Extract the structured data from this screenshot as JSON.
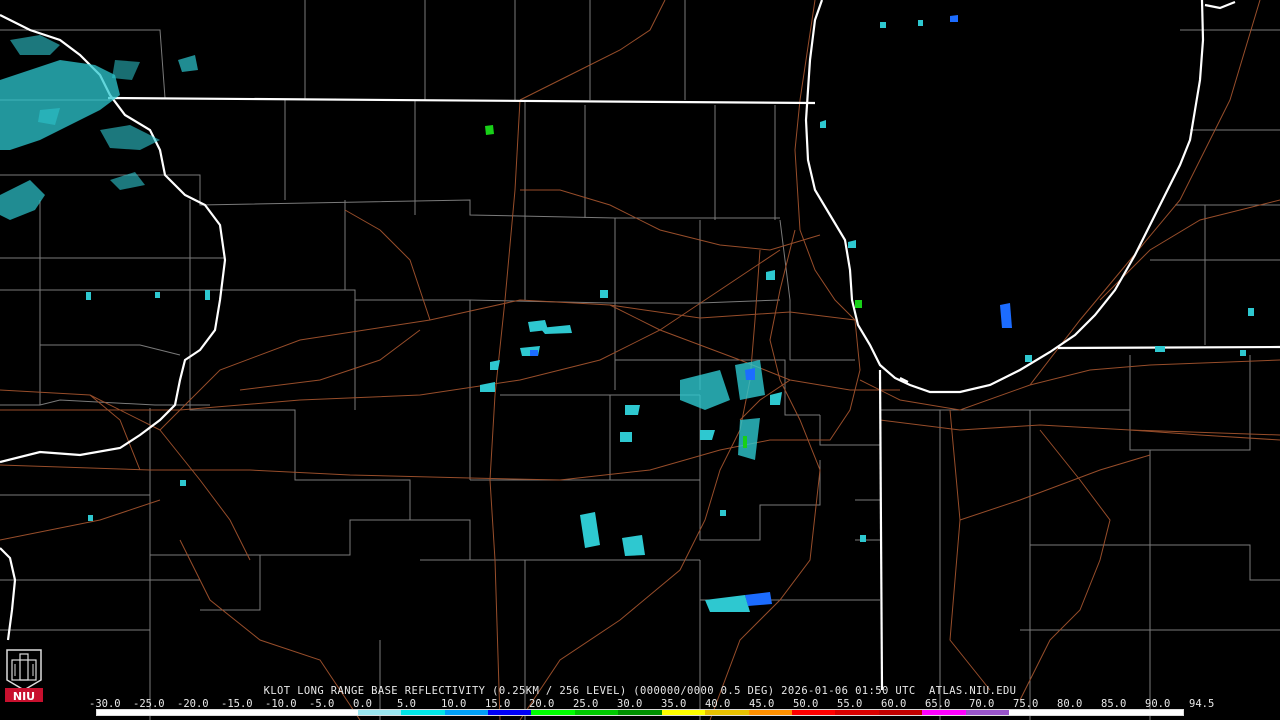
{
  "caption": "KLOT LONG RANGE BASE REFLECTIVITY (0.25KM / 256 LEVEL) (000000/0000 0.5 DEG) 2026-01-06 01:50 UTC  ATLAS.NIU.EDU",
  "scale": {
    "labels": [
      "-30.0",
      "-25.0",
      "-20.0",
      "-15.0",
      "-10.0",
      "-5.0",
      "0.0",
      "5.0",
      "10.0",
      "15.0",
      "20.0",
      "25.0",
      "30.0",
      "35.0",
      "40.0",
      "45.0",
      "50.0",
      "55.0",
      "60.0",
      "65.0",
      "70.0",
      "75.0",
      "80.0",
      "85.0",
      "90.0",
      "94.5"
    ],
    "colors": [
      "#ffffff",
      "#ffffff",
      "#ffffff",
      "#ffffff",
      "#ffffff",
      "#ffffff",
      "#9be7f0",
      "#00e5e5",
      "#01a0f6",
      "#0000f6",
      "#00ff00",
      "#00c800",
      "#009000",
      "#ffff00",
      "#e7c000",
      "#ff9000",
      "#ff0000",
      "#d60000",
      "#c00000",
      "#ff00ff",
      "#9955c9",
      "#ffffff",
      "#ffffff",
      "#ffffff",
      "#ffffff"
    ]
  },
  "logo": {
    "text": "NIU",
    "name": "niu-logo"
  },
  "colors": {
    "background": "#000000",
    "state_border": "#ffffff",
    "county_line": "#7a7a7a",
    "highway": "#a0522d",
    "echo_light": "#2ec8d0",
    "echo_medium": "#1c6cff",
    "echo_strong": "#18d018"
  }
}
